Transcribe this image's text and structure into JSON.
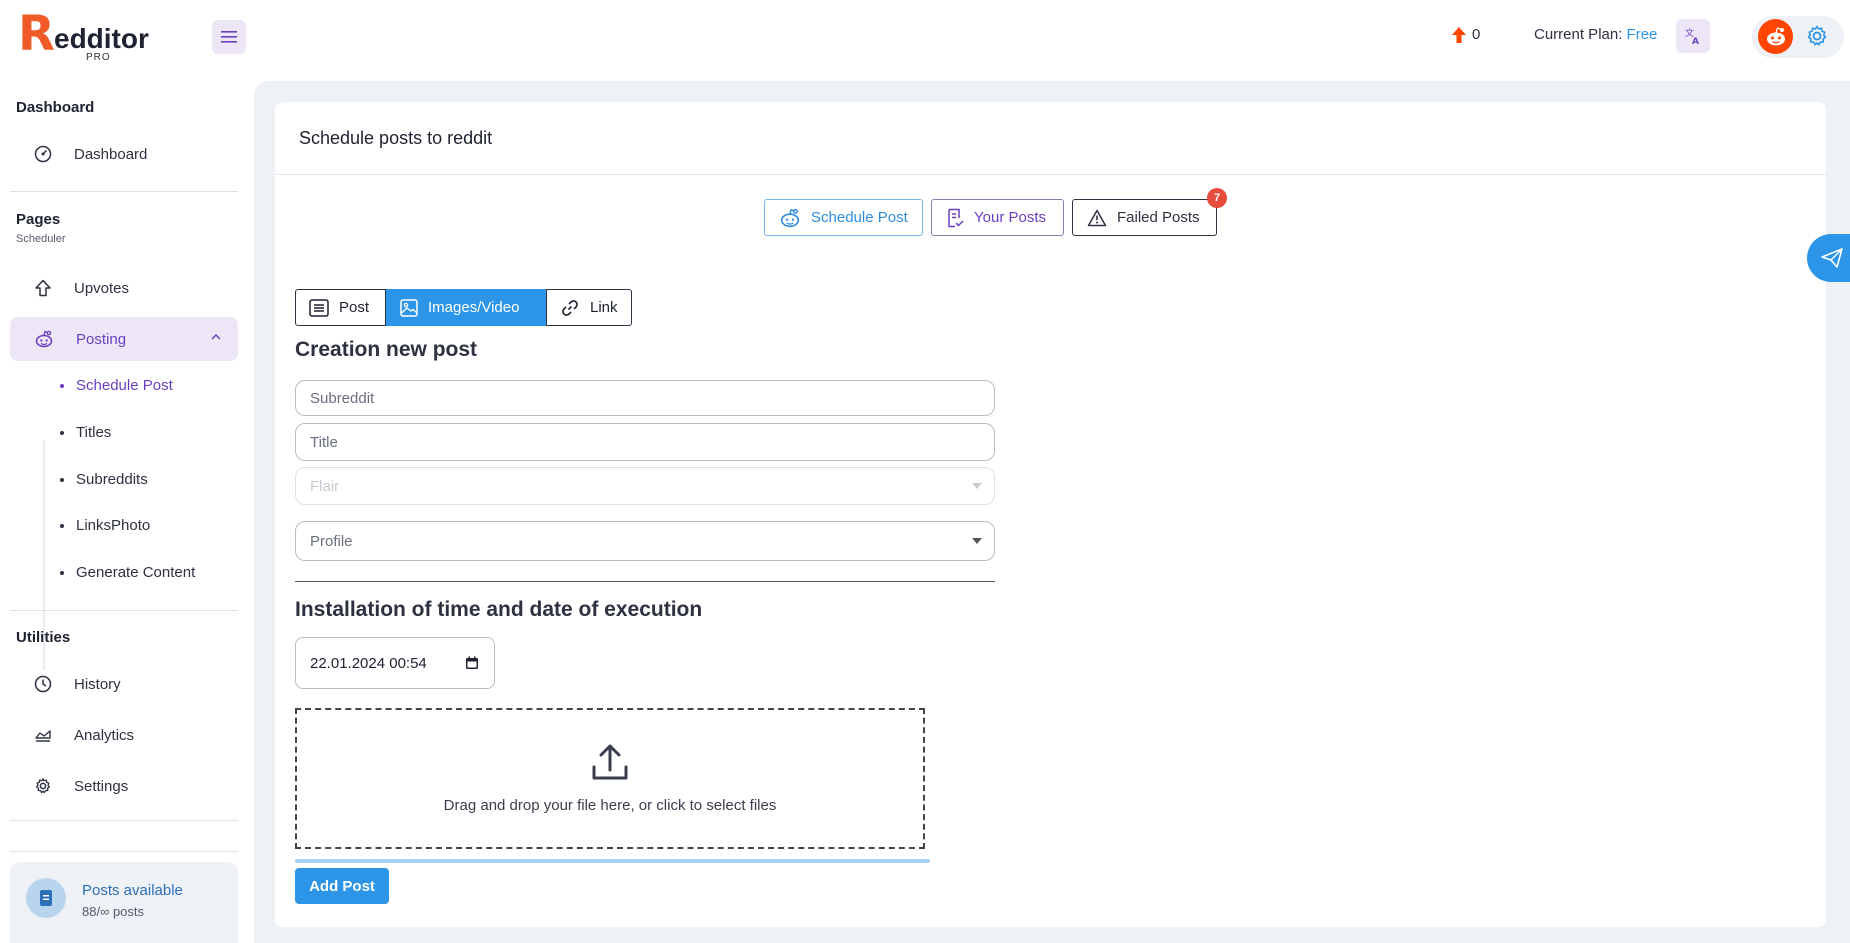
{
  "brand": {
    "logo_letter": "R",
    "logo_text": "edditor",
    "logo_sub": "PRO"
  },
  "header": {
    "upvotes": "0",
    "plan_label": "Current Plan:",
    "plan_value": "Free"
  },
  "sidebar": {
    "sections": {
      "dashboard": "Dashboard",
      "pages": "Pages",
      "pages_sub": "Scheduler",
      "utilities": "Utilities"
    },
    "items": {
      "dashboard": "Dashboard",
      "upvotes": "Upvotes",
      "posting": "Posting",
      "history": "History",
      "analytics": "Analytics",
      "settings": "Settings"
    },
    "posting_sub": [
      "Schedule Post",
      "Titles",
      "Subreddits",
      "LinksPhoto",
      "Generate Content"
    ],
    "posts_available": {
      "title": "Posts available",
      "count": "88/∞ posts"
    }
  },
  "main": {
    "card_title": "Schedule posts to reddit",
    "tabs": {
      "schedule": "Schedule Post",
      "yours": "Your Posts",
      "failed": "Failed Posts",
      "failed_badge": "7"
    },
    "types": {
      "post": "Post",
      "images": "Images/Video",
      "link": "Link"
    },
    "creation_heading": "Creation new post",
    "fields": {
      "subreddit": "Subreddit",
      "title": "Title",
      "flair": "Flair",
      "profile": "Profile"
    },
    "schedule_heading": "Installation of time and date of execution",
    "datetime": "22.01.2024 00:54",
    "dropzone_text": "Drag and drop your file here, or click to select files",
    "add_button": "Add Post"
  },
  "colors": {
    "accent": "#2d95e8",
    "purple": "#6a3fbf",
    "reddit": "#ff4500",
    "badge": "#e74c3c"
  }
}
